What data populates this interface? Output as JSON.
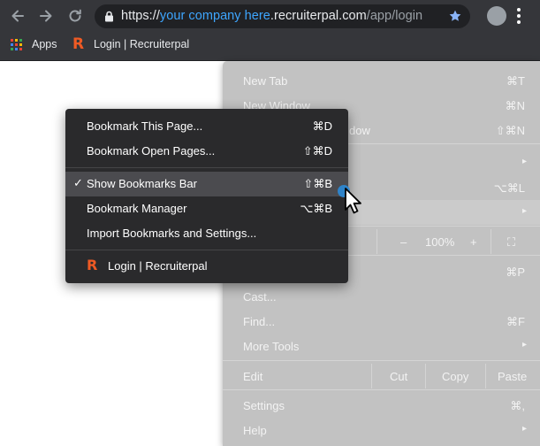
{
  "browser": {
    "url": {
      "scheme": "https://",
      "highlight": "your company here",
      "domain": ".recruiterpal.com",
      "path": "/app/login"
    },
    "icons": {
      "back": "back-arrow-icon",
      "forward": "forward-arrow-icon",
      "reload": "reload-icon",
      "lock": "lock-icon",
      "star": "bookmark-star-icon",
      "profile": "profile-avatar",
      "menu": "kebab-menu-icon"
    },
    "colors": {
      "toolbar": "#35363a",
      "url_highlight": "#3ea6ff",
      "star": "#8ab4f8",
      "logo": "#ef5a24"
    }
  },
  "bookmarks_bar": {
    "apps_label": "Apps",
    "item_logo": "R",
    "item_label": "Login | Recruiterpal"
  },
  "main_menu": {
    "new_tab": {
      "label": "New Tab",
      "shortcut": "⌘T"
    },
    "new_window": {
      "label": "New Window",
      "shortcut": "⌘N"
    },
    "incognito": {
      "label": "dow",
      "shortcut": "⇧⌘N"
    },
    "history_arrow": "▸",
    "downloads_shortcut": "⌥⌘L",
    "bookmarks_arrow": "▸",
    "zoom": {
      "minus": "–",
      "value": "100%",
      "plus": "+",
      "fullscreen": "⛶"
    },
    "print_shortcut": "⌘P",
    "cast": {
      "label": "Cast..."
    },
    "find": {
      "label": "Find...",
      "shortcut": "⌘F"
    },
    "more_tools": {
      "label": "More Tools",
      "arrow": "▸"
    },
    "edit": {
      "label": "Edit",
      "cut": "Cut",
      "copy": "Copy",
      "paste": "Paste"
    },
    "settings": {
      "label": "Settings",
      "shortcut": "⌘,"
    },
    "help": {
      "label": "Help",
      "arrow": "▸"
    }
  },
  "bookmarks_menu": {
    "items": [
      {
        "label": "Bookmark This Page...",
        "shortcut": "⌘D"
      },
      {
        "label": "Bookmark Open Pages...",
        "shortcut": "⇧⌘D"
      },
      {
        "label": "Show Bookmarks Bar",
        "shortcut": "⇧⌘B",
        "checked": true,
        "check_mark": "✓"
      },
      {
        "label": "Bookmark Manager",
        "shortcut": "⌥⌘B"
      },
      {
        "label": "Import Bookmarks and Settings...",
        "shortcut": ""
      },
      {
        "label": "Login | Recruiterpal",
        "shortcut": "",
        "logo": "R"
      }
    ]
  }
}
